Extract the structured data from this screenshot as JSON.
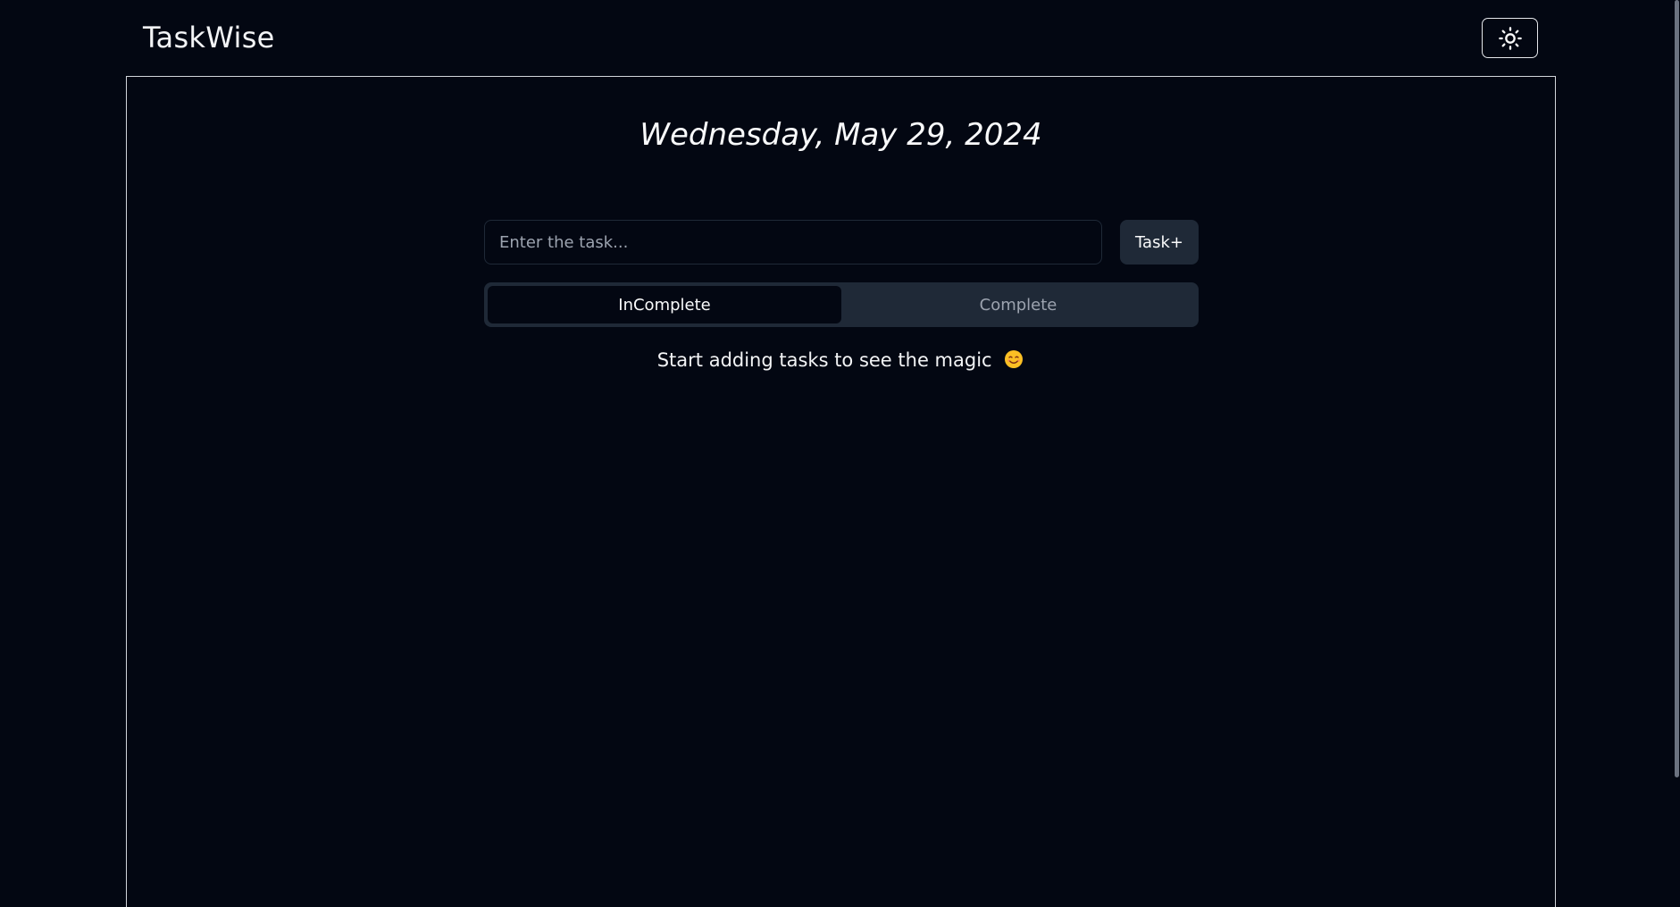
{
  "header": {
    "app_title": "TaskWise",
    "theme_toggle_icon": "sun-icon"
  },
  "main": {
    "date_heading": "Wednesday, May 29, 2024",
    "task_input": {
      "placeholder": "Enter the task...",
      "value": ""
    },
    "add_button_label": "Task+",
    "tabs": [
      {
        "label": "InComplete",
        "active": true
      },
      {
        "label": "Complete",
        "active": false
      }
    ],
    "empty_message": "Start adding tasks to see the magic",
    "empty_message_icon": "smiling-face-icon"
  },
  "colors": {
    "background": "#030712",
    "surface": "#1f2937",
    "text": "#f9fafb",
    "muted_text": "#9ca3af",
    "border": "#d1d5db",
    "emoji": "#fbbf24"
  }
}
